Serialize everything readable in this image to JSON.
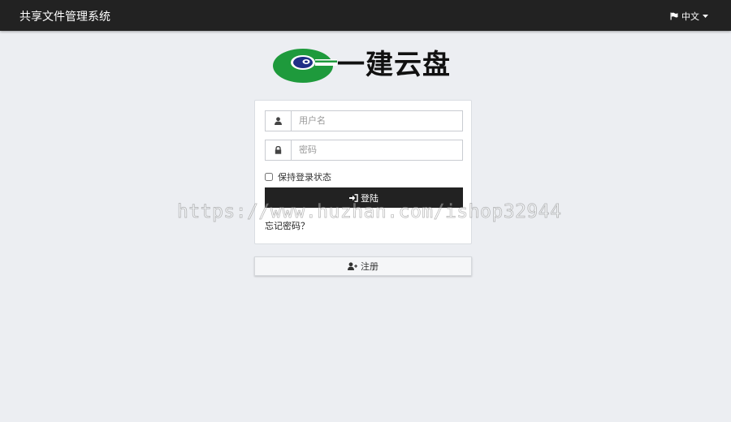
{
  "header": {
    "title": "共享文件管理系统",
    "language": "中文"
  },
  "logo": {
    "text": "一建云盘"
  },
  "login": {
    "username_placeholder": "用户名",
    "password_placeholder": "密码",
    "remember_label": "保持登录状态",
    "submit_label": "登陆",
    "forgot_label": "忘记密码？"
  },
  "register": {
    "label": "注册"
  },
  "watermark": "https://www.huzhan.com/ishop32944",
  "colors": {
    "navbar": "#222222",
    "background": "#eceef2",
    "logo_green": "#1e9a3c",
    "logo_blue": "#1f2f86"
  }
}
